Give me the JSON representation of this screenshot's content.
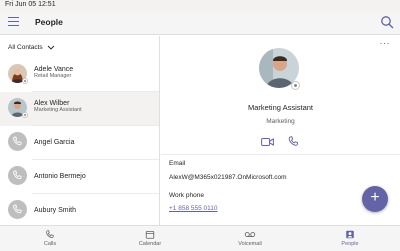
{
  "status_bar": {
    "time": "Fri Jun 05  12:51"
  },
  "header": {
    "title": "People"
  },
  "filter": {
    "label": "All Contacts"
  },
  "contacts": [
    {
      "name": "Adele Vance",
      "subtitle": "Retail Manager",
      "avatar": "photo"
    },
    {
      "name": "Alex Wilber",
      "subtitle": "Marketing Assistant",
      "avatar": "photo"
    },
    {
      "name": "Angel Garcia",
      "subtitle": "",
      "avatar": "phone-icon"
    },
    {
      "name": "Antonio Bermejo",
      "subtitle": "",
      "avatar": "phone-icon"
    },
    {
      "name": "Aubury Smith",
      "subtitle": "",
      "avatar": "phone-icon"
    }
  ],
  "detail": {
    "more": "···",
    "job_title": "Marketing Assistant",
    "department": "Marketing",
    "fields": [
      {
        "label": "Email",
        "value": "AlexW@M365x021987.OnMicrosoft.com"
      },
      {
        "label": "Work phone",
        "value": "+1 858 555 0110"
      }
    ]
  },
  "fab": {
    "symbol": "+"
  },
  "nav": [
    {
      "label": "Calls",
      "icon": "phone-icon"
    },
    {
      "label": "Calendar",
      "icon": "calendar-icon"
    },
    {
      "label": "Voicemail",
      "icon": "voicemail-icon"
    },
    {
      "label": "People",
      "icon": "people-icon"
    }
  ],
  "colors": {
    "accent": "#6264a7",
    "bar": "#f5f5f5",
    "selected_row": "#f3f2f1"
  }
}
